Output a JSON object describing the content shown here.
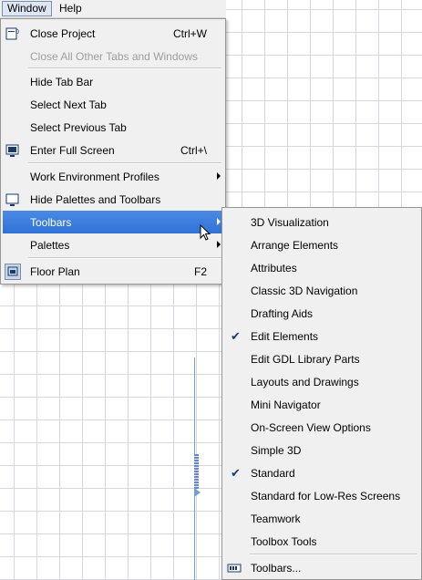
{
  "menubar": {
    "window": "Window",
    "help": "Help"
  },
  "window_menu": [
    {
      "label": "Close Project",
      "shortcut": "Ctrl+W",
      "icon": "close-project-icon"
    },
    {
      "label": "Close All Other Tabs and Windows",
      "disabled": true
    },
    {
      "separator": true
    },
    {
      "label": "Hide Tab Bar"
    },
    {
      "label": "Select Next Tab"
    },
    {
      "label": "Select Previous Tab"
    },
    {
      "label": "Enter Full Screen",
      "shortcut": "Ctrl+\\",
      "icon": "full-screen-icon"
    },
    {
      "separator": true
    },
    {
      "label": "Work Environment Profiles",
      "submenu": true
    },
    {
      "label": "Hide Palettes and Toolbars",
      "icon": "hide-palettes-icon"
    },
    {
      "label": "Toolbars",
      "submenu": true,
      "highlighted": true
    },
    {
      "label": "Palettes",
      "submenu": true
    },
    {
      "separator": true
    },
    {
      "label": "Floor Plan",
      "shortcut": "F2",
      "icon": "floor-plan-icon"
    }
  ],
  "toolbars_menu": [
    {
      "label": "3D Visualization"
    },
    {
      "label": "Arrange Elements"
    },
    {
      "label": "Attributes"
    },
    {
      "label": "Classic 3D Navigation"
    },
    {
      "label": "Drafting Aids"
    },
    {
      "label": "Edit Elements",
      "checked": true
    },
    {
      "label": "Edit GDL Library Parts"
    },
    {
      "label": "Layouts and Drawings"
    },
    {
      "label": "Mini Navigator"
    },
    {
      "label": "On-Screen View Options"
    },
    {
      "label": "Simple 3D"
    },
    {
      "label": "Standard",
      "checked": true
    },
    {
      "label": "Standard for Low-Res Screens"
    },
    {
      "label": "Teamwork"
    },
    {
      "label": "Toolbox Tools"
    },
    {
      "separator": true
    },
    {
      "label": "Toolbars...",
      "icon": "toolbars-dialog-icon"
    }
  ],
  "check_glyph": "✔",
  "colors": {
    "highlight": "#3d7fe0",
    "menu_bg": "#f0f0f0",
    "disabled": "#9e9e9e"
  }
}
